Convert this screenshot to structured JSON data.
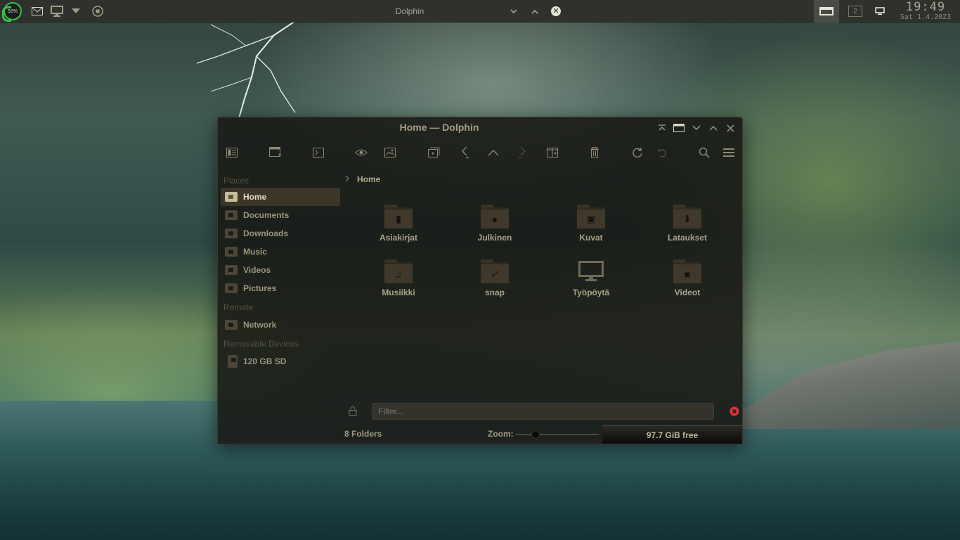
{
  "panel": {
    "battery_text": "92%",
    "active_title": "Dolphin",
    "desktop_number": "2",
    "time": "19:49",
    "date": "Sat 1.4.2023"
  },
  "window": {
    "title": "Home — Dolphin"
  },
  "places": {
    "sections": {
      "places": "Places",
      "remote": "Remote",
      "removable": "Removable Devices"
    },
    "items": [
      {
        "label": "Home",
        "icon": "home-icon"
      },
      {
        "label": "Documents",
        "icon": "documents-folder-icon"
      },
      {
        "label": "Downloads",
        "icon": "downloads-folder-icon"
      },
      {
        "label": "Music",
        "icon": "music-folder-icon"
      },
      {
        "label": "Videos",
        "icon": "videos-folder-icon"
      },
      {
        "label": "Pictures",
        "icon": "pictures-folder-icon"
      }
    ],
    "remote_items": [
      {
        "label": "Network",
        "icon": "network-icon"
      }
    ],
    "removable_items": [
      {
        "label": "120 GB SD",
        "icon": "sd-card-icon"
      }
    ]
  },
  "breadcrumb": {
    "current": "Home"
  },
  "folders": [
    {
      "name": "Asiakirjat",
      "glyph": "▮",
      "icon": "documents-folder-icon"
    },
    {
      "name": "Julkinen",
      "glyph": "●",
      "icon": "public-folder-icon"
    },
    {
      "name": "Kuvat",
      "glyph": "▣",
      "icon": "pictures-folder-icon"
    },
    {
      "name": "Lataukset",
      "glyph": "⬇",
      "icon": "downloads-folder-icon"
    },
    {
      "name": "Musiikki",
      "glyph": "♫",
      "icon": "music-folder-icon"
    },
    {
      "name": "snap",
      "glyph": "➶",
      "icon": "snap-folder-icon"
    },
    {
      "name": "Työpöytä",
      "glyph": "",
      "icon": "desktop-monitor-icon"
    },
    {
      "name": "Videot",
      "glyph": "■",
      "icon": "videos-folder-icon"
    }
  ],
  "filter": {
    "placeholder": "Filter..."
  },
  "status": {
    "folders": "8 Folders",
    "zoom_label": "Zoom:",
    "free_space": "97.7 GiB free"
  },
  "colors": {
    "accent": "#3ac04a",
    "selection": "#3c3629",
    "close_red": "#e0343a"
  }
}
